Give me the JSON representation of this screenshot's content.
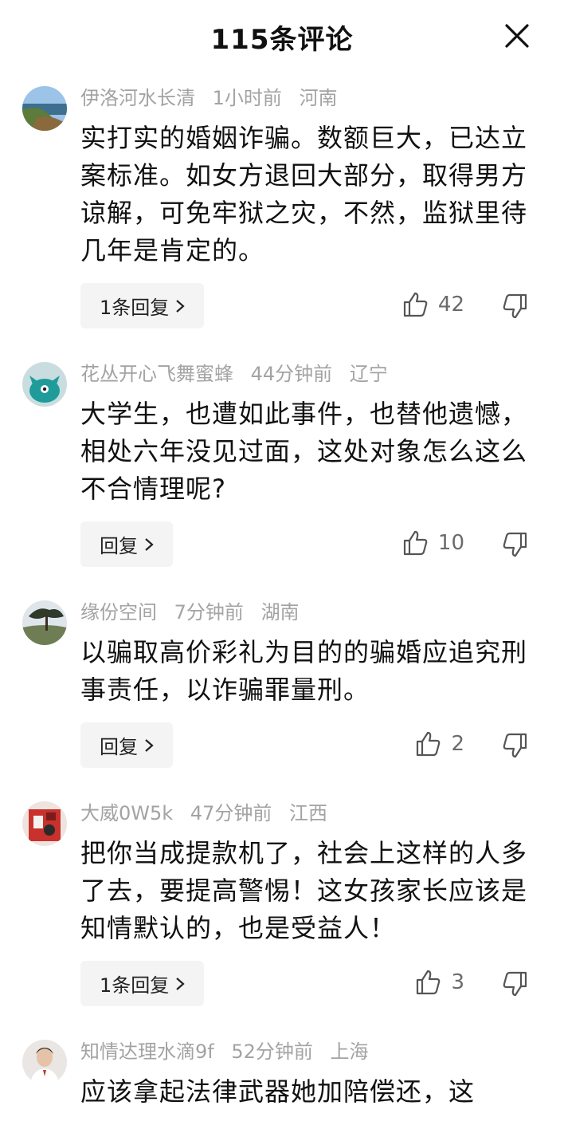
{
  "header": {
    "title": "115条评论"
  },
  "comments": [
    {
      "user": "伊洛河水长清",
      "time": "1小时前",
      "location": "河南",
      "text": "实打实的婚姻诈骗。数额巨大，已达立案标准。如女方退回大部分，取得男方谅解，可免牢狱之灾，不然，监狱里待几年是肯定的。",
      "reply_label": "1条回复",
      "likes": "42",
      "avatar_icon": "landscape-avatar-icon"
    },
    {
      "user": "花丛开心飞舞蜜蜂",
      "time": "44分钟前",
      "location": "辽宁",
      "text": "大学生，也遭如此事件，也替他遗憾，相处六年没见过面，这处对象怎么这么不合情理呢?",
      "reply_label": "回复",
      "likes": "10",
      "avatar_icon": "teal-creature-avatar-icon"
    },
    {
      "user": "缘份空间",
      "time": "7分钟前",
      "location": "湖南",
      "text": "以骗取高价彩礼为目的的骗婚应追究刑事责任，以诈骗罪量刑。",
      "reply_label": "回复",
      "likes": "2",
      "avatar_icon": "tree-avatar-icon"
    },
    {
      "user": "大威0W5k",
      "time": "47分钟前",
      "location": "江西",
      "text": "把你当成提款机了，社会上这样的人多了去，要提高警惕！这女孩家长应该是知情默认的，也是受益人！",
      "reply_label": "1条回复",
      "likes": "3",
      "avatar_icon": "red-photo-avatar-icon"
    },
    {
      "user": "知情达理水滴9f",
      "time": "52分钟前",
      "location": "上海",
      "text": "应该拿起法律武器她加陪偿还，这",
      "avatar_icon": "person-avatar-icon"
    }
  ]
}
